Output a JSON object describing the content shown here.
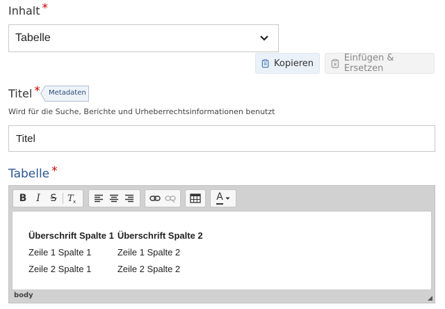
{
  "inhalt": {
    "label": "Inhalt",
    "required_mark": "*",
    "selected": "Tabelle",
    "copy_button": "Kopieren",
    "paste_button": "Einfügen & Ersetzen"
  },
  "titel": {
    "label": "Titel",
    "required_mark": "*",
    "badge": "Metadaten",
    "help": "Wird für die Suche, Berichte und Urheberrechtsinformationen benutzt",
    "value": "Titel"
  },
  "tabelle": {
    "label": "Tabelle",
    "required_mark": "*",
    "toolbar": {
      "bold": "B",
      "italic": "I",
      "strike": "S",
      "font_color": "A"
    },
    "table": {
      "headers": [
        "Überschrift Spalte 1",
        "Überschrift Spalte 2"
      ],
      "rows": [
        [
          "Zeile 1 Spalte 1",
          "Zeile 1 Spalte 2"
        ],
        [
          "Zeile 2 Spalte 1",
          "Zeile 2 Spalte 2"
        ]
      ]
    },
    "status_path": "body"
  },
  "colors": {
    "required": "#cc0000",
    "section_label": "#2b5592",
    "badge_text": "#2c4c7c"
  }
}
